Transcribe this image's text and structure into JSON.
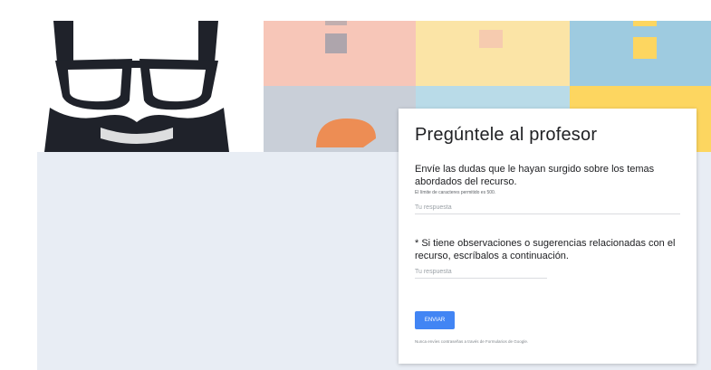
{
  "form": {
    "title": "Pregúntele al profesor",
    "question_1": "Envíe las dudas que le hayan surgido sobre los temas abordados del recurso.",
    "question_1_hint": "El límite de caracteres permitido es 500.",
    "answer_placeholder": "Tu respuesta",
    "question_2": "* Si tiene observaciones o sugerencias relacionadas con el recurso, escríbalos a continuación.",
    "submit_label": "ENVIAR",
    "footer_note": "Nunca envíes contraseñas a través de Formularios de Google."
  },
  "header_image": {
    "icons": [
      "bearded-face-with-glasses-icon",
      "question-mark-icon"
    ],
    "tile_colors": [
      "#f7c6b8",
      "#fbe4a6",
      "#9ecbe0",
      "#c9cfd8",
      "#b9dbe8",
      "#fdd660",
      "#ed8d54",
      "#4a4f5a"
    ]
  },
  "colors": {
    "canvas": "#e8edf4",
    "accent": "#4285f4",
    "card": "#ffffff"
  }
}
